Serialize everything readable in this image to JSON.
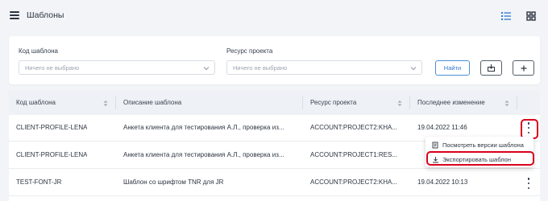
{
  "header": {
    "title": "Шаблоны",
    "menu_icon": "hamburger-menu-icon",
    "view_list_icon": "list-view-icon",
    "view_grid_icon": "grid-view-icon",
    "accent_color": "#2f7ad1"
  },
  "filters": {
    "template_code": {
      "label": "Код шаблона",
      "placeholder": "Ничего не выбрано"
    },
    "project_resource": {
      "label": "Ресурс проекта",
      "placeholder": "Ничего не выбрано"
    },
    "find_label": "Найти",
    "add_icon": "add-icon",
    "import_icon": "import-icon"
  },
  "table": {
    "columns": [
      "Код шаблона",
      "Описание шаблона",
      "Ресурс проекта",
      "Последнее изменение"
    ],
    "rows": [
      {
        "code": "CLIENT-PROFILE-LENA",
        "description": "Анкета клиента для тестирования А.Л., проверка из...",
        "resource": "ACCOUNT:PROJECT2:KHA...",
        "modified": "19.04.2022 11:46"
      },
      {
        "code": "CLIENT-PROFILE-LENA",
        "description": "Анкета клиента для тестирования А.Л., проверка из...",
        "resource": "ACCOUNT:PROJECT1:RES...",
        "modified": ""
      },
      {
        "code": "TEST-FONT-JR",
        "description": "Шаблон со шрифтом TNR для JR",
        "resource": "ACCOUNT:PROJECT2:KHA...",
        "modified": "19.04.2022 10:13"
      }
    ]
  },
  "context_menu": {
    "items": [
      {
        "label": "Посмотреть версии шаблона",
        "icon": "versions-icon"
      },
      {
        "label": "Экспортировать шаблон",
        "icon": "download-icon"
      }
    ],
    "highlight_color": "#d9001b"
  }
}
